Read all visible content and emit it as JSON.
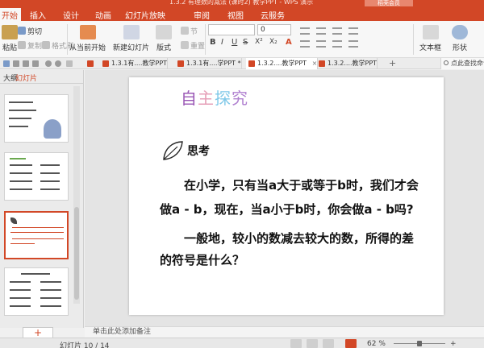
{
  "window": {
    "title": "1.3.2 有理数的减法 (课时2) 教学PPT - WPS 演示",
    "top_button": "稻壳会员"
  },
  "menu": {
    "tabs": [
      "开始",
      "插入",
      "设计",
      "动画",
      "幻灯片放映",
      "审阅",
      "视图",
      "云服务"
    ]
  },
  "ribbon": {
    "paste": "粘贴",
    "cut": "剪切",
    "copy": "复制",
    "format_painter": "格式刷",
    "from_current": "从当前开始",
    "new_slide": "新建幻灯片",
    "layout": "版式",
    "section": "节",
    "reset": "重置",
    "font_size": "0",
    "textbox": "文本框",
    "shape": "形状",
    "format_b": "B",
    "format_i": "I",
    "format_u": "U",
    "format_s": "S",
    "format_x2": "X²",
    "format_x2b": "X₂",
    "format_a": "A"
  },
  "doc_tabs": [
    {
      "label": "1.3.1有....教学PPT",
      "active": false
    },
    {
      "label": "1.3.1有....学PPT *",
      "active": false
    },
    {
      "label": "1.3.2....教学PPT",
      "active": true
    },
    {
      "label": "1.3.2....教学PPT",
      "active": false
    }
  ],
  "search": {
    "text": "点此查找命令"
  },
  "left_pane": {
    "tab_outline": "大纲",
    "tab_slides": "幻灯片",
    "add_button": "+"
  },
  "slide": {
    "title_chars": [
      "自",
      "主",
      "探",
      "究"
    ],
    "heading": "思考",
    "para1_line1": "在小学，只有当a大于或等于b时，我们才会",
    "para1_line2": "做a - b，现在，当a小于b时，你会做a - b吗?",
    "para2_line1": "一般地，较小的数减去较大的数，所得的差",
    "para2_line2": "的符号是什么？"
  },
  "notes": {
    "placeholder": "单击此处添加备注"
  },
  "status": {
    "slide_info": "幻灯片 10 / 14",
    "zoom": "62 %"
  },
  "colors": {
    "accent": "#d24726"
  }
}
